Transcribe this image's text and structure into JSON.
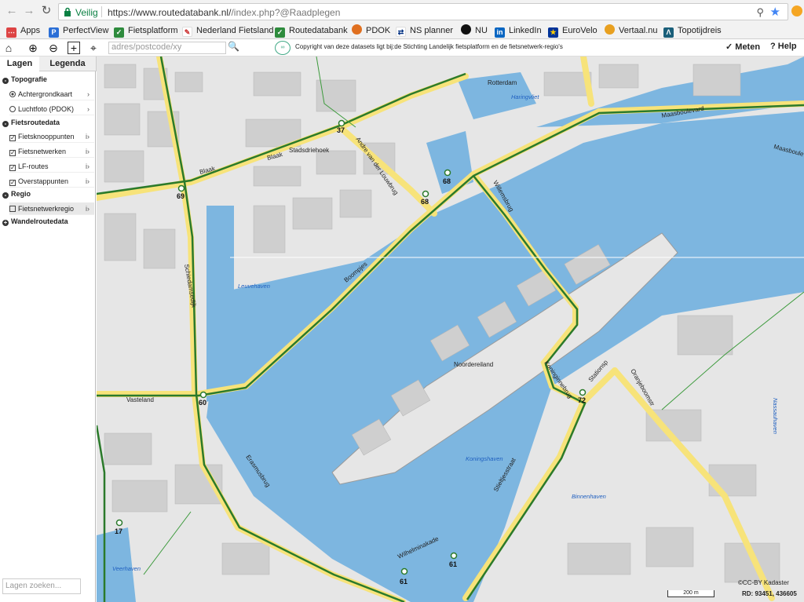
{
  "browser": {
    "security_label": "Veilig",
    "url_main": "https://www.routedatabank.nl/",
    "url_rest": "/index.php?@Raadplegen",
    "bookmarks": [
      {
        "label": "Apps",
        "icon": "apps-grid-icon"
      },
      {
        "label": "PerfectView",
        "icon": "perfectview-icon"
      },
      {
        "label": "Fietsplatform",
        "icon": "fietsplatform-icon"
      },
      {
        "label": "Nederland Fietsland",
        "icon": "fietsland-icon"
      },
      {
        "label": "Routedatabank",
        "icon": "routedatabank-icon"
      },
      {
        "label": "PDOK",
        "icon": "pdok-icon"
      },
      {
        "label": "NS planner",
        "icon": "ns-icon"
      },
      {
        "label": "NU",
        "icon": "nu-icon"
      },
      {
        "label": "LinkedIn",
        "icon": "linkedin-icon"
      },
      {
        "label": "EuroVelo",
        "icon": "eurovelo-icon"
      },
      {
        "label": "Vertaal.nu",
        "icon": "vertaal-icon"
      },
      {
        "label": "Topotijdreis",
        "icon": "topotijdreis-icon"
      }
    ]
  },
  "toolbar": {
    "search_placeholder": "adres/postcode/xy",
    "copyright": "Copyright van deze datasets ligt bij:de Stichting Landelijk fietsplatform en de fietsnetwerk-regio's",
    "meten_label": "Meten",
    "help_label": "Help"
  },
  "sidebar": {
    "tabs": [
      "Lagen",
      "Legenda"
    ],
    "collapse_label": "<",
    "groups": [
      {
        "label": "Topografie"
      },
      {
        "label": "Fietsroutedata"
      },
      {
        "label": "Regio"
      },
      {
        "label": "Wandelroutedata"
      }
    ],
    "items": [
      {
        "label": "Achtergrondkaart"
      },
      {
        "label": "Luchtfoto (PDOK)"
      },
      {
        "label": "Fietsknooppunten"
      },
      {
        "label": "Fietsnetwerken"
      },
      {
        "label": "LF-routes"
      },
      {
        "label": "Overstappunten"
      },
      {
        "label": "Fietsnetwerkregio"
      }
    ],
    "layer_search_placeholder": "Lagen zoeken..."
  },
  "map": {
    "street_labels": [
      "Blaak",
      "Blaak",
      "Stadsdriehoek",
      "Andre van der Louwbrug",
      "Boompjes",
      "Schiedamsedijk",
      "Vasteland",
      "Erasmusbrug",
      "Willemsbrug",
      "Maasboulevard",
      "Koninginnebrug",
      "Oranjeboomstr",
      "Stieltjesstraat",
      "Wilhelminakade",
      "Stationsp",
      "Rotterdam",
      "Noordereiland",
      "Maasboulev"
    ],
    "water_labels": [
      "Haringvliet",
      "Leuvehaven",
      "Koningshaven",
      "Binnenhaven",
      "Nassauhaven",
      "Veerhaven"
    ],
    "nodes": [
      "37",
      "69",
      "68",
      "68",
      "60",
      "72",
      "17",
      "61",
      "61"
    ],
    "scale_label": "200 m",
    "attribution": "©CC-BY Kadaster",
    "coords": "RD: 93451, 436605"
  }
}
